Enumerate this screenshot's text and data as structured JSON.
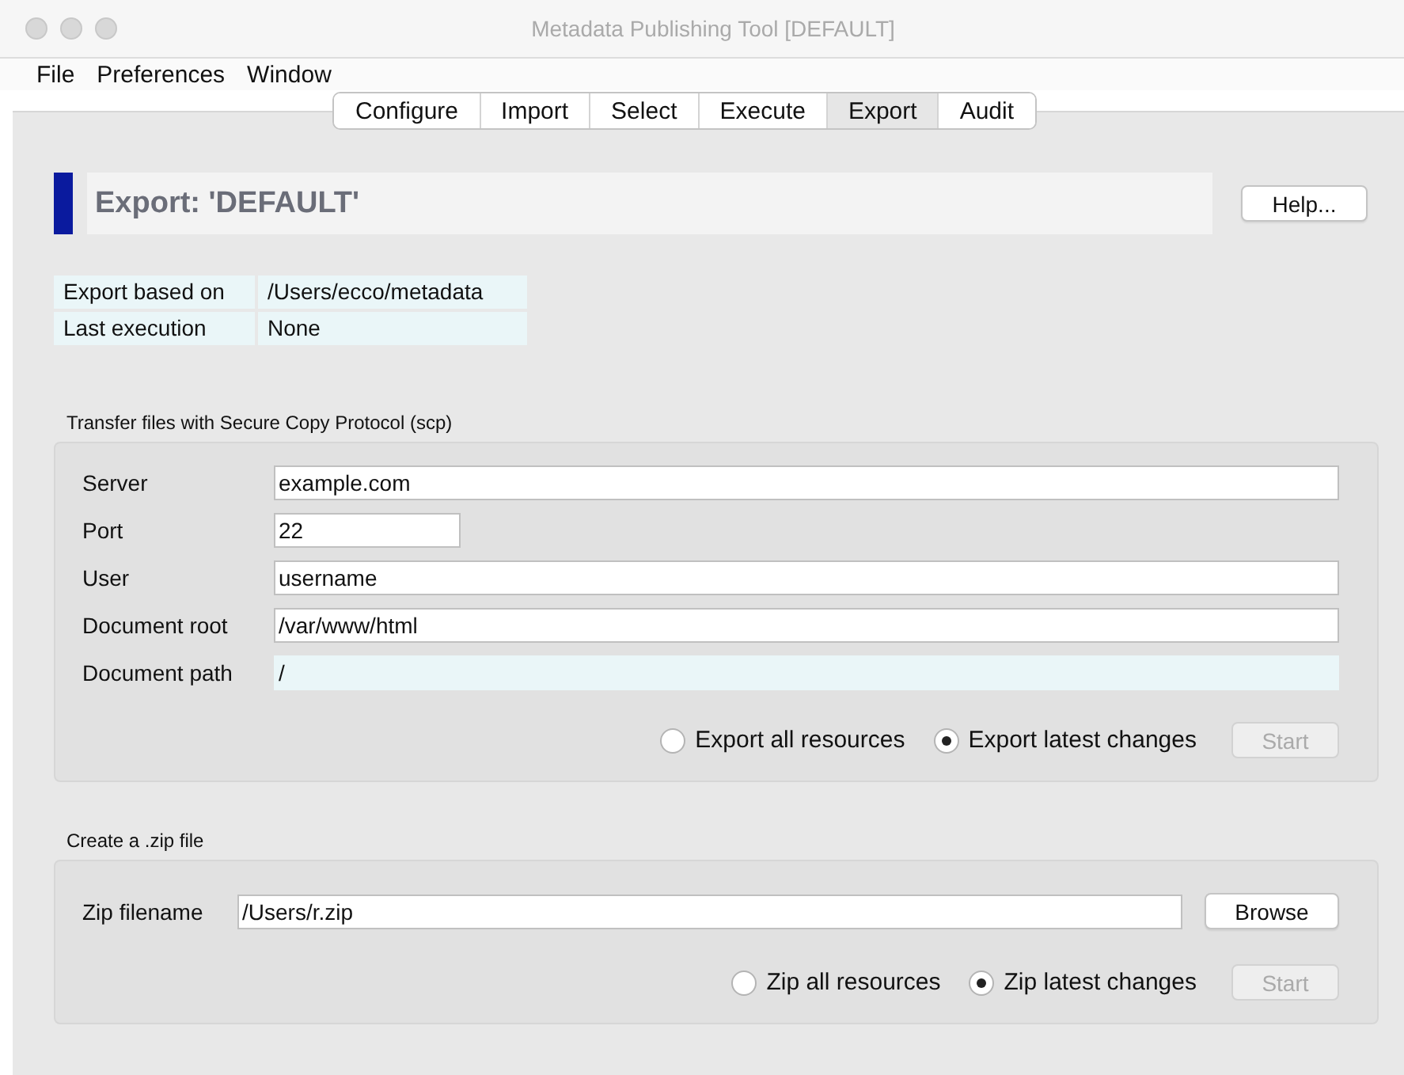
{
  "window": {
    "title": "Metadata Publishing Tool [DEFAULT]"
  },
  "menu": [
    "File",
    "Preferences",
    "Window"
  ],
  "tabs": [
    {
      "label": "Configure",
      "selected": false
    },
    {
      "label": "Import",
      "selected": false
    },
    {
      "label": "Select",
      "selected": false
    },
    {
      "label": "Execute",
      "selected": false
    },
    {
      "label": "Export",
      "selected": true
    },
    {
      "label": "Audit",
      "selected": false
    }
  ],
  "heading": "Export: 'DEFAULT'",
  "help_button": "Help...",
  "info": [
    {
      "label": "Export based on",
      "value": "/Users/ecco/metadata"
    },
    {
      "label": "Last execution",
      "value": "None"
    }
  ],
  "scp": {
    "title": "Transfer files with Secure Copy Protocol (scp)",
    "fields": [
      {
        "label": "Server",
        "value": "example.com",
        "kind": "input"
      },
      {
        "label": "Port",
        "value": "22",
        "kind": "short"
      },
      {
        "label": "User",
        "value": "username",
        "kind": "input"
      },
      {
        "label": "Document root",
        "value": "/var/www/html",
        "kind": "input"
      },
      {
        "label": "Document path",
        "value": "/",
        "kind": "readonly"
      }
    ],
    "options": [
      {
        "label": "Export all resources",
        "selected": false
      },
      {
        "label": "Export latest changes",
        "selected": true
      }
    ],
    "start": {
      "label": "Start",
      "disabled": true
    }
  },
  "zip": {
    "title": "Create a .zip file",
    "field": {
      "label": "Zip filename",
      "value": "/Users/r.zip"
    },
    "browse_button": "Browse",
    "options": [
      {
        "label": "Zip all resources",
        "selected": false
      },
      {
        "label": "Zip latest changes",
        "selected": true
      }
    ],
    "start": {
      "label": "Start",
      "disabled": true
    }
  }
}
